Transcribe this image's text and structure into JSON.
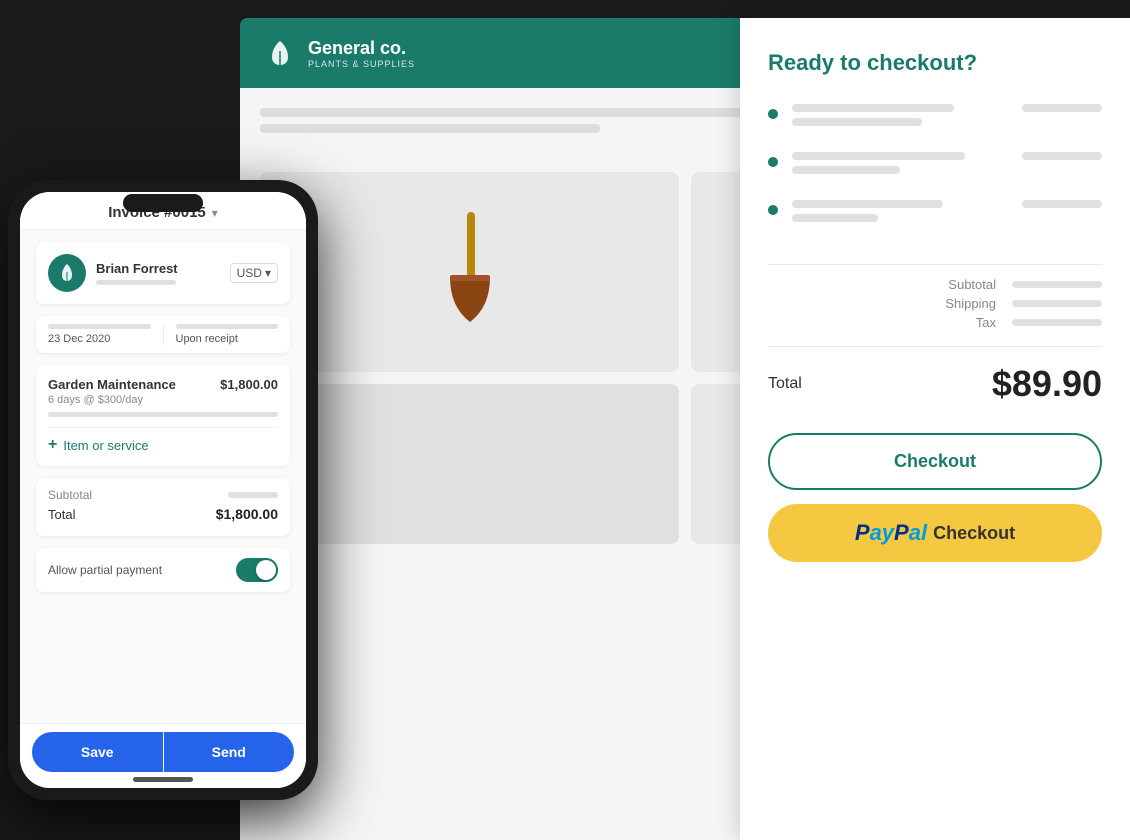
{
  "app": {
    "name": "General co.",
    "subtitle": "PLANTS & SUPPLIES"
  },
  "invoice": {
    "title": "Invoice #0015",
    "client_name": "Brian Forrest",
    "currency": "USD",
    "date": "23 Dec 2020",
    "due": "Upon receipt",
    "line_items": [
      {
        "name": "Garden Maintenance",
        "price": "$1,800.00",
        "description": "6 days @ $300/day"
      }
    ],
    "add_item_label": "Item or service",
    "subtotal_label": "Subtotal",
    "total_label": "Total",
    "total_value": "$1,800.00",
    "partial_payment_label": "Allow partial payment",
    "save_btn": "Save",
    "send_btn": "Send"
  },
  "checkout": {
    "title": "Ready to checkout?",
    "total_label": "Total",
    "total_amount": "$89.90",
    "subtotal_label": "Subtotal",
    "shipping_label": "Shipping",
    "tax_label": "Tax",
    "checkout_btn": "Checkout",
    "paypal_p": "P",
    "paypal_al": "ayPal",
    "paypal_checkout": "Checkout"
  }
}
